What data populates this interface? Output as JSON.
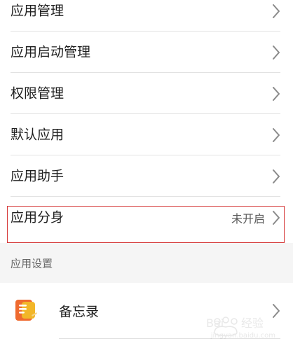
{
  "menu": {
    "items": [
      {
        "label": "应用管理"
      },
      {
        "label": "应用启动管理"
      },
      {
        "label": "权限管理"
      },
      {
        "label": "默认应用"
      },
      {
        "label": "应用助手"
      },
      {
        "label": "应用分身",
        "value": "未开启"
      }
    ]
  },
  "section": {
    "title": "应用设置"
  },
  "apps": [
    {
      "label": "备忘录",
      "icon": "notes-icon"
    }
  ],
  "watermark": {
    "text": "jingyan.baidu.com"
  },
  "colors": {
    "text_primary": "#1f1f1f",
    "text_secondary": "#666666",
    "divider": "#e2e2e2",
    "highlight": "#d63a3a",
    "section_bg": "#f5f5f5"
  }
}
